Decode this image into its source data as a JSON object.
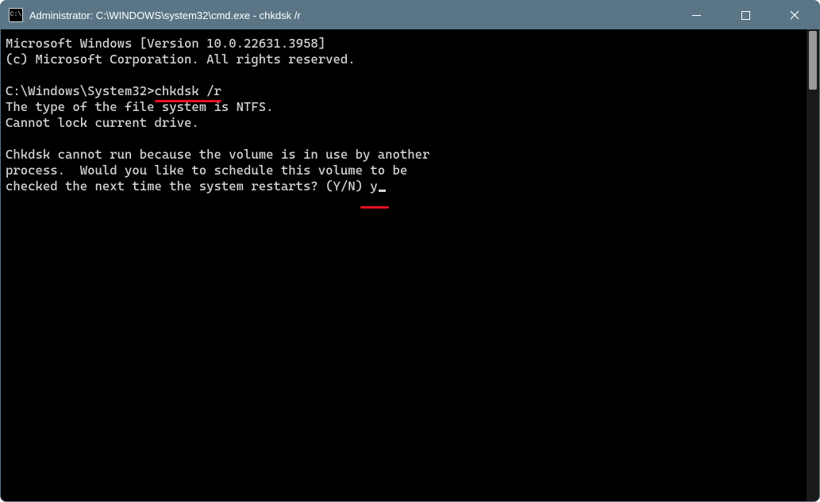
{
  "titlebar": {
    "icon_label": "C:\\",
    "title": "Administrator: C:\\WINDOWS\\system32\\cmd.exe - chkdsk  /r"
  },
  "terminal": {
    "line_version": "Microsoft Windows [Version 10.0.22631.3958]",
    "line_copyright": "(c) Microsoft Corporation. All rights reserved.",
    "prompt": "C:\\Windows\\System32>",
    "command": "chkdsk /r",
    "out_fs_type": "The type of the file system is NTFS.",
    "out_cannot_lock": "Cannot lock current drive.",
    "out_sched_1": "Chkdsk cannot run because the volume is in use by another",
    "out_sched_2": "process.  Would you like to schedule this volume to be",
    "out_sched_3_prefix": "checked the next time the system restarts? (Y/N) ",
    "user_answer": "y"
  }
}
